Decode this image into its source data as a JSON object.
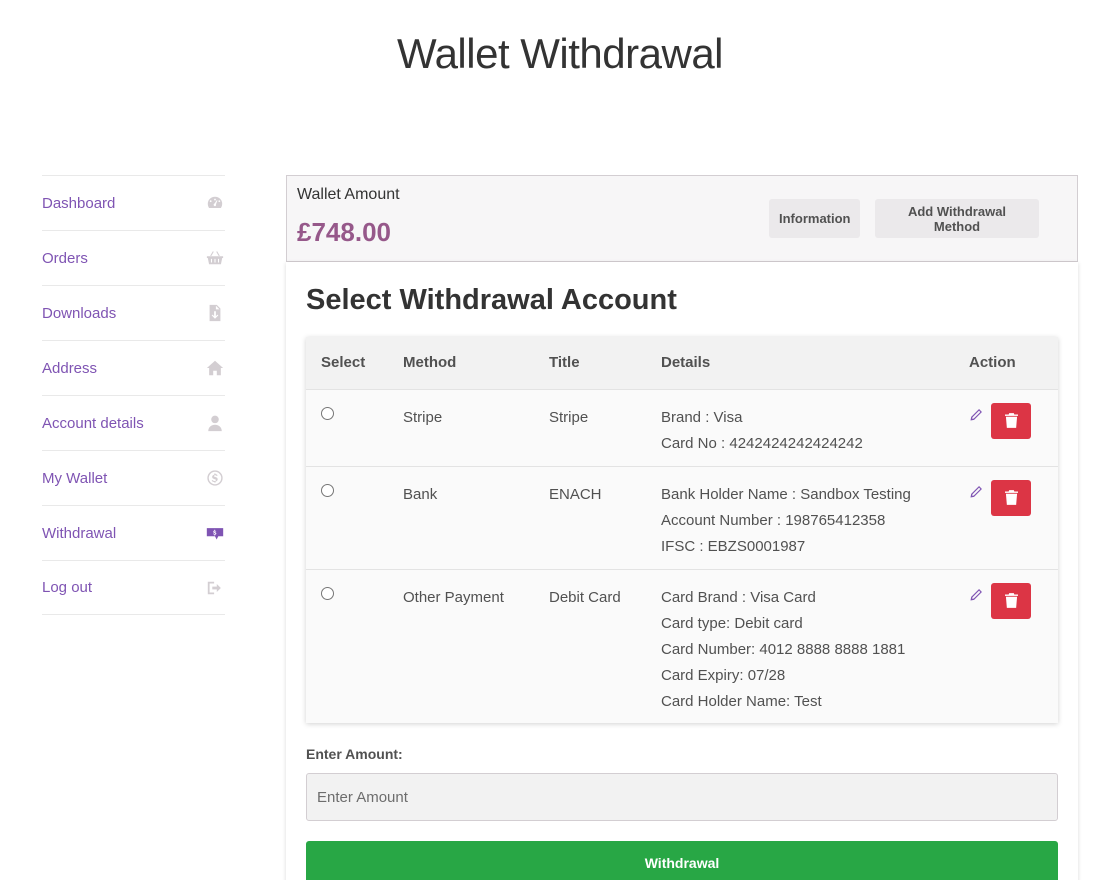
{
  "page": {
    "title": "Wallet Withdrawal"
  },
  "sidebar": {
    "items": [
      {
        "label": "Dashboard",
        "icon": "dashboard-gauge-icon"
      },
      {
        "label": "Orders",
        "icon": "basket-icon"
      },
      {
        "label": "Downloads",
        "icon": "file-download-icon"
      },
      {
        "label": "Address",
        "icon": "home-icon"
      },
      {
        "label": "Account details",
        "icon": "user-icon"
      },
      {
        "label": "My Wallet",
        "icon": "dollar-circle-icon"
      },
      {
        "label": "Withdrawal",
        "icon": "withdrawal-icon",
        "active": true
      },
      {
        "label": "Log out",
        "icon": "sign-out-icon"
      }
    ]
  },
  "wallet": {
    "label": "Wallet Amount",
    "amount": "£748.00",
    "information_label": "Information",
    "add_method_label": "Add Withdrawal Method"
  },
  "accounts": {
    "title": "Select Withdrawal Account",
    "columns": [
      "Select",
      "Method",
      "Title",
      "Details",
      "Action"
    ],
    "rows": [
      {
        "method": "Stripe",
        "title": "Stripe",
        "details": [
          "Brand : Visa",
          "Card No : 4242424242424242"
        ]
      },
      {
        "method": "Bank",
        "title": "ENACH",
        "details": [
          "Bank Holder Name : Sandbox Testing",
          "Account Number : 198765412358",
          "IFSC : EBZS0001987"
        ]
      },
      {
        "method": "Other Payment",
        "title": "Debit Card",
        "details": [
          "Card Brand : Visa Card",
          "Card type: Debit card",
          "Card Number: 4012 8888 8888 1881",
          "Card Expiry: 07/28",
          "Card Holder Name: Test"
        ]
      }
    ]
  },
  "amount": {
    "label": "Enter Amount:",
    "placeholder": "Enter Amount",
    "value": ""
  },
  "submit": {
    "label": "Withdrawal"
  },
  "colors": {
    "link": "#7f54b3",
    "amount": "#96588a",
    "delete": "#dc3545",
    "submit": "#28a745"
  }
}
